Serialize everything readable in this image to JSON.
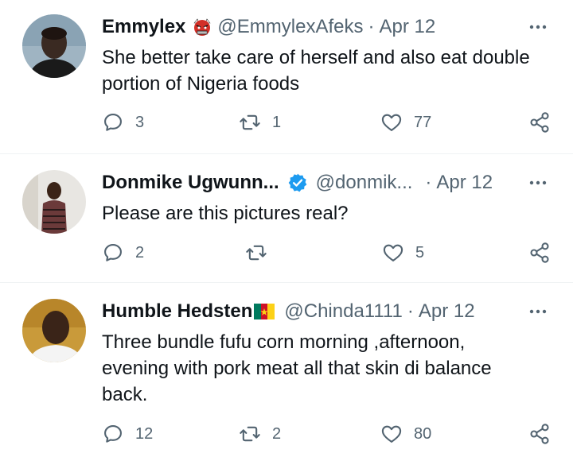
{
  "replies": [
    {
      "name": "Emmylex",
      "name_emoji": "ogre-emoji",
      "handle": "@EmmylexAfeks",
      "separator": "·",
      "date": "Apr 12",
      "text": "She better take care of herself and also eat double portion of Nigeria foods",
      "reply_count": "3",
      "retweet_count": "1",
      "like_count": "77",
      "verified": false
    },
    {
      "name": "Donmike Ugwunn...",
      "handle": "@donmik...",
      "separator": "·",
      "date": "Apr 12",
      "text": "Please are this pictures real?",
      "reply_count": "2",
      "retweet_count": "",
      "like_count": "5",
      "verified": true
    },
    {
      "name": "Humble Hedsten",
      "name_emoji": "cameroon-flag",
      "handle": "@Chinda1111",
      "separator": "·",
      "date": "Apr 12",
      "text": "Three bundle fufu corn morning ,afternoon, evening with pork meat all that skin di balance back.",
      "reply_count": "12",
      "retweet_count": "2",
      "like_count": "80",
      "verified": false
    }
  ],
  "colors": {
    "text_primary": "#0f1419",
    "text_secondary": "#536471",
    "verified_blue": "#1d9bf0",
    "divider": "#eff3f4"
  },
  "icons": [
    "reply-icon",
    "retweet-icon",
    "like-icon",
    "share-icon",
    "more-icon",
    "verified-badge-icon"
  ]
}
